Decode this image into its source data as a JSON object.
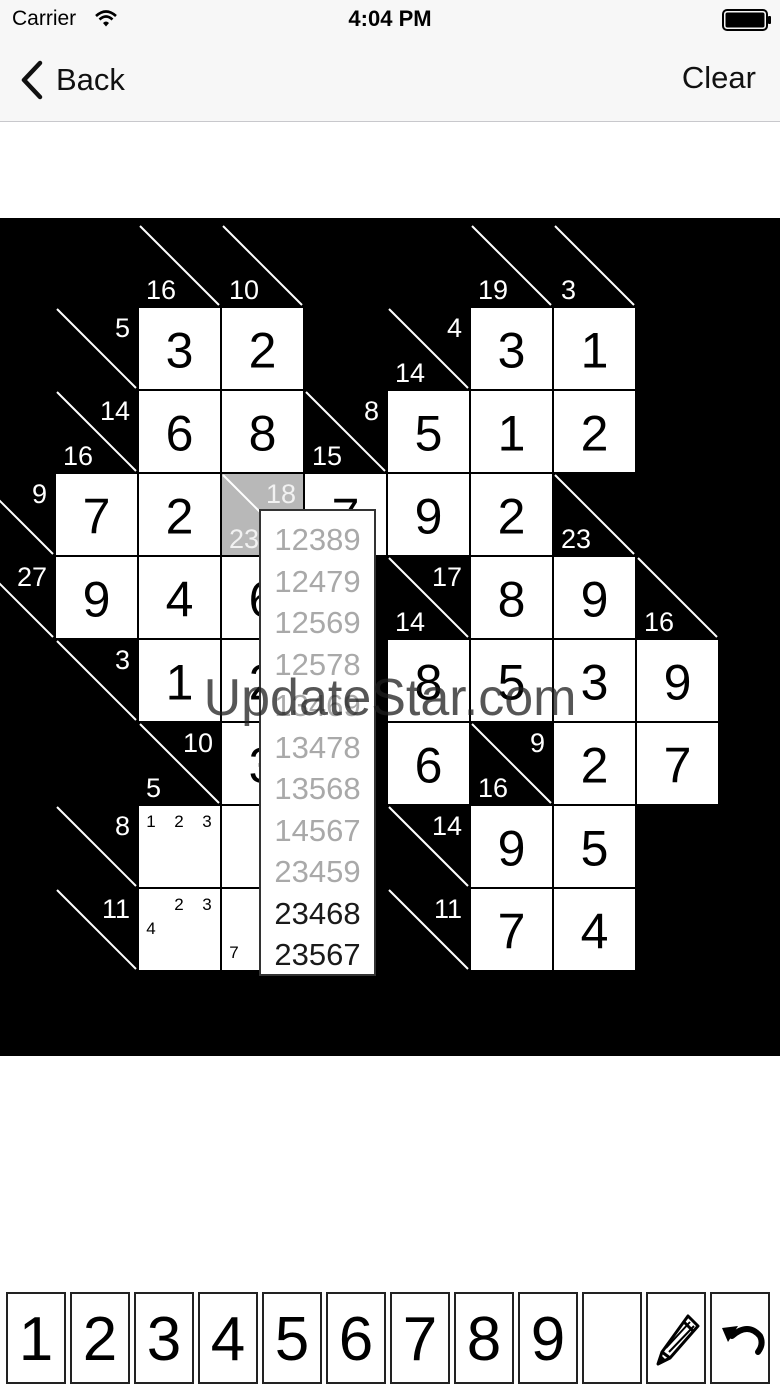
{
  "status_bar": {
    "carrier": "Carrier",
    "time": "4:04 PM"
  },
  "nav": {
    "back_label": "Back",
    "clear_label": "Clear"
  },
  "watermark": "UpdateStar.com",
  "board": {
    "rows": 9,
    "cols": 9,
    "cells": [
      {
        "r": 0,
        "c": 1,
        "type": "clue",
        "down": "16"
      },
      {
        "r": 0,
        "c": 2,
        "type": "clue",
        "down": "10"
      },
      {
        "r": 0,
        "c": 5,
        "type": "clue",
        "down": "19"
      },
      {
        "r": 0,
        "c": 6,
        "type": "clue",
        "down": "3"
      },
      {
        "r": 1,
        "c": 0,
        "type": "clue",
        "across": "5"
      },
      {
        "r": 1,
        "c": 1,
        "type": "value",
        "value": "3"
      },
      {
        "r": 1,
        "c": 2,
        "type": "value",
        "value": "2"
      },
      {
        "r": 1,
        "c": 4,
        "type": "clue",
        "across": "4",
        "down": "14"
      },
      {
        "r": 1,
        "c": 5,
        "type": "value",
        "value": "3"
      },
      {
        "r": 1,
        "c": 6,
        "type": "value",
        "value": "1"
      },
      {
        "r": 2,
        "c": 0,
        "type": "clue",
        "across": "14",
        "down": "16"
      },
      {
        "r": 2,
        "c": 1,
        "type": "value",
        "value": "6"
      },
      {
        "r": 2,
        "c": 2,
        "type": "value",
        "value": "8"
      },
      {
        "r": 2,
        "c": 3,
        "type": "clue",
        "across": "8",
        "down": "15"
      },
      {
        "r": 2,
        "c": 4,
        "type": "value",
        "value": "5"
      },
      {
        "r": 2,
        "c": 5,
        "type": "value",
        "value": "1"
      },
      {
        "r": 2,
        "c": 6,
        "type": "value",
        "value": "2"
      },
      {
        "r": 3,
        "c": -1,
        "type": "clue",
        "across": "9"
      },
      {
        "r": 3,
        "c": 0,
        "type": "value",
        "value": "7"
      },
      {
        "r": 3,
        "c": 1,
        "type": "value",
        "value": "2"
      },
      {
        "r": 3,
        "c": 2,
        "type": "clue-selected",
        "across": "18",
        "down": "23"
      },
      {
        "r": 3,
        "c": 3,
        "type": "value",
        "value": "7"
      },
      {
        "r": 3,
        "c": 4,
        "type": "value",
        "value": "9"
      },
      {
        "r": 3,
        "c": 5,
        "type": "value",
        "value": "2"
      },
      {
        "r": 3,
        "c": 6,
        "type": "clue",
        "down": "23"
      },
      {
        "r": 4,
        "c": -1,
        "type": "clue",
        "across": "27"
      },
      {
        "r": 4,
        "c": 0,
        "type": "value",
        "value": "9"
      },
      {
        "r": 4,
        "c": 1,
        "type": "value",
        "value": "4"
      },
      {
        "r": 4,
        "c": 2,
        "type": "value",
        "value": "6"
      },
      {
        "r": 4,
        "c": 4,
        "type": "clue",
        "across": "17",
        "down": "14"
      },
      {
        "r": 4,
        "c": 5,
        "type": "value",
        "value": "8"
      },
      {
        "r": 4,
        "c": 6,
        "type": "value",
        "value": "9"
      },
      {
        "r": 4,
        "c": 7,
        "type": "clue",
        "down": "16"
      },
      {
        "r": 5,
        "c": 0,
        "type": "clue",
        "across": "3"
      },
      {
        "r": 5,
        "c": 1,
        "type": "value",
        "value": "1"
      },
      {
        "r": 5,
        "c": 2,
        "type": "value",
        "value": "2"
      },
      {
        "r": 5,
        "c": 4,
        "type": "value",
        "value": "8"
      },
      {
        "r": 5,
        "c": 5,
        "type": "value",
        "value": "5"
      },
      {
        "r": 5,
        "c": 6,
        "type": "value",
        "value": "3"
      },
      {
        "r": 5,
        "c": 7,
        "type": "value",
        "value": "9"
      },
      {
        "r": 6,
        "c": 1,
        "type": "clue",
        "across": "10",
        "down": "5"
      },
      {
        "r": 6,
        "c": 2,
        "type": "value",
        "value": "3"
      },
      {
        "r": 6,
        "c": 4,
        "type": "value",
        "value": "6"
      },
      {
        "r": 6,
        "c": 5,
        "type": "clue",
        "across": "9",
        "down": "16"
      },
      {
        "r": 6,
        "c": 6,
        "type": "value",
        "value": "2"
      },
      {
        "r": 6,
        "c": 7,
        "type": "value",
        "value": "7"
      },
      {
        "r": 7,
        "c": 0,
        "type": "clue",
        "across": "8"
      },
      {
        "r": 7,
        "c": 1,
        "type": "pencil",
        "marks": [
          "1",
          "2",
          "3",
          "",
          "",
          "",
          "",
          "",
          ""
        ]
      },
      {
        "r": 7,
        "c": 2,
        "type": "empty"
      },
      {
        "r": 7,
        "c": 4,
        "type": "clue",
        "across": "14"
      },
      {
        "r": 7,
        "c": 5,
        "type": "value",
        "value": "9"
      },
      {
        "r": 7,
        "c": 6,
        "type": "value",
        "value": "5"
      },
      {
        "r": 8,
        "c": 0,
        "type": "clue",
        "across": "11"
      },
      {
        "r": 8,
        "c": 1,
        "type": "pencil",
        "marks": [
          "",
          "2",
          "3",
          "4",
          "",
          "",
          "",
          "",
          ""
        ]
      },
      {
        "r": 8,
        "c": 2,
        "type": "pencil",
        "marks": [
          "",
          "",
          "",
          "",
          "",
          "",
          "7",
          "",
          ""
        ]
      },
      {
        "r": 8,
        "c": 4,
        "type": "clue",
        "across": "11"
      },
      {
        "r": 8,
        "c": 5,
        "type": "value",
        "value": "7"
      },
      {
        "r": 8,
        "c": 6,
        "type": "value",
        "value": "4"
      }
    ]
  },
  "combinations_popup": {
    "items": [
      {
        "text": "12389",
        "available": false
      },
      {
        "text": "12479",
        "available": false
      },
      {
        "text": "12569",
        "available": false
      },
      {
        "text": "12578",
        "available": false
      },
      {
        "text": "13469",
        "available": false
      },
      {
        "text": "13478",
        "available": false
      },
      {
        "text": "13568",
        "available": false
      },
      {
        "text": "14567",
        "available": false
      },
      {
        "text": "23459",
        "available": false
      },
      {
        "text": "23468",
        "available": true
      },
      {
        "text": "23567",
        "available": true
      }
    ]
  },
  "keypad": {
    "digits": [
      "1",
      "2",
      "3",
      "4",
      "5",
      "6",
      "7",
      "8",
      "9"
    ],
    "blank_key": "",
    "pencil_icon": "pencil-icon",
    "undo_icon": "undo-icon"
  }
}
